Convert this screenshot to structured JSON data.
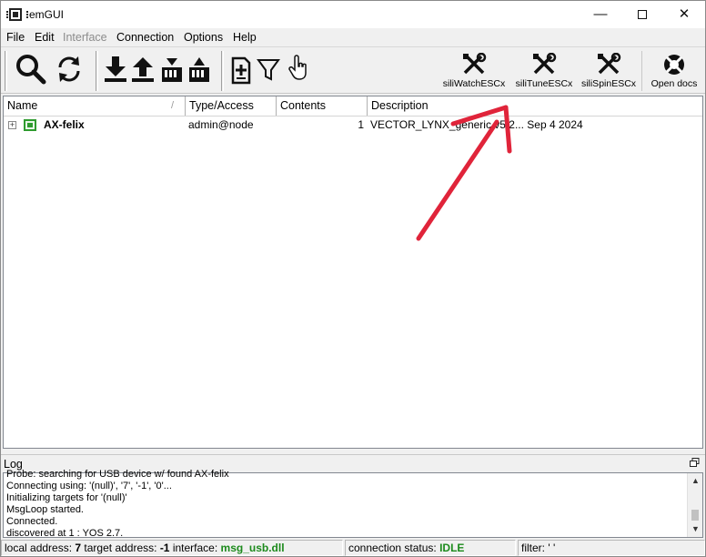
{
  "window": {
    "title": "emGUI",
    "minimize_glyph": "—",
    "close_glyph": "✕"
  },
  "menu": [
    {
      "label": "File",
      "enabled": true
    },
    {
      "label": "Edit",
      "enabled": true
    },
    {
      "label": "Interface",
      "enabled": false
    },
    {
      "label": "Connection",
      "enabled": true
    },
    {
      "label": "Options",
      "enabled": true
    },
    {
      "label": "Help",
      "enabled": true
    }
  ],
  "toolbar": {
    "icons": [
      "search-icon",
      "refresh-icon",
      "download-icon",
      "upload-icon",
      "download-to-device-icon",
      "upload-from-device-icon",
      "add-config-icon",
      "filter-icon",
      "pointer-icon"
    ],
    "named_tools": [
      {
        "label": "siliWatchESCx",
        "icon": "tools-icon"
      },
      {
        "label": "siliTuneESCx",
        "icon": "tools-icon"
      },
      {
        "label": "siliSpinESCx",
        "icon": "tools-icon"
      },
      {
        "label": "Open docs",
        "icon": "help-lifebuoy-icon"
      }
    ]
  },
  "list": {
    "columns": [
      "Name",
      "Type/Access",
      "Contents",
      "Description"
    ],
    "sort_indicator": "/",
    "rows": [
      {
        "name": "AX-felix",
        "type_access": "admin@node",
        "contents": "1",
        "description": "VECTOR_LYNX_generic v5.2... Sep  4 2024"
      }
    ]
  },
  "log": {
    "title": "Log",
    "lines": [
      "Probe: searching for USB device w/ found AX-felix",
      "Connecting using: '(null)', '7', '-1', '0'...",
      "Initializing targets for '(null)'",
      "MsgLoop started.",
      "Connected.",
      "discovered at 1 : YOS 2.7."
    ]
  },
  "status": {
    "local_label": "local address:",
    "local_value": "7",
    "target_label": "target address:",
    "target_value": "-1",
    "interface_label": "interface:",
    "interface_value": "msg_usb.dll",
    "connection_label": "connection status:",
    "connection_value": "IDLE",
    "filter_label": "filter:",
    "filter_value": "' '"
  },
  "colors": {
    "status_ok": "#1c8a1c",
    "device_icon": "#2f9b2f",
    "annotation_arrow": "#e0243a"
  }
}
